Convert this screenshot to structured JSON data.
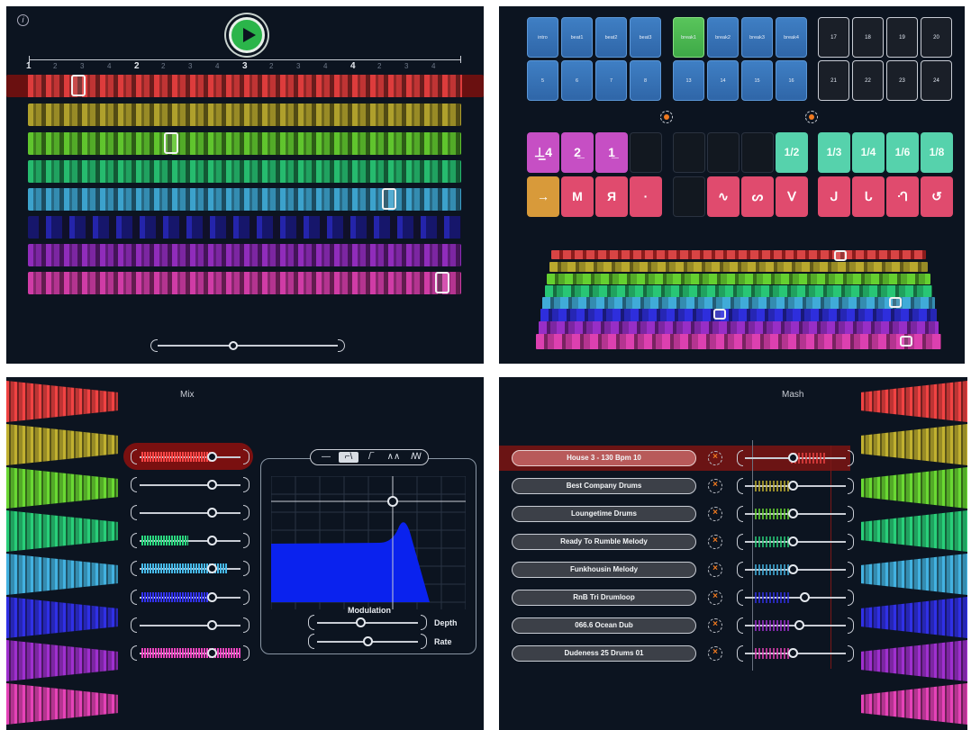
{
  "colors": {
    "background": "#0c1420",
    "tracks": [
      "#d23a3a",
      "#a89a2a",
      "#5cbd2c",
      "#24b46a",
      "#3a9bc4",
      "#2a2ac8",
      "#8a2ab4",
      "#c83aa0"
    ],
    "play": "#2bb54a",
    "accent_orange": "#f07a20"
  },
  "arranger": {
    "info_icon": "info-icon",
    "play_icon": "play-icon",
    "ruler": [
      "1",
      "2",
      "3",
      "4",
      "2",
      "2",
      "3",
      "4",
      "3",
      "2",
      "3",
      "4",
      "4",
      "2",
      "3",
      "4"
    ]
  },
  "pads": {
    "scenes_blue": [
      "intro",
      "beat1",
      "beat2",
      "beat3",
      "break1",
      "break2",
      "break3",
      "break4",
      "5",
      "6",
      "7",
      "8",
      "13",
      "14",
      "15",
      "16"
    ],
    "scenes_dark": [
      "17",
      "18",
      "19",
      "20",
      "21",
      "22",
      "23",
      "24"
    ],
    "fx_row1": [
      "⊥̲4",
      "2̲",
      "1̲",
      "",
      "",
      "",
      "",
      "1/2",
      "1/3",
      "1/4",
      "1/6",
      "1/8"
    ],
    "fx_row2": [
      "→",
      "M",
      "Я",
      "·",
      "",
      "∿",
      "ᔕ",
      "ᐯ",
      "ᒍ",
      "ᒐ",
      "ᒒ",
      "↺"
    ]
  },
  "mix": {
    "title": "Mix",
    "filter_options": [
      "—",
      "⌐\\",
      "/‾",
      "∧∧",
      "ꟿ"
    ],
    "modulation_label": "Modulation",
    "depth_label": "Depth",
    "rate_label": "Rate"
  },
  "mash": {
    "title": "Mash",
    "loops": [
      "House 3 - 130 Bpm 10",
      "Best Company Drums",
      "Loungetime Drums",
      "Ready To Rumble Melody",
      "Funkhousin Melody",
      "RnB Tri Drumloop",
      "066.6 Ocean Dub",
      "Dudeness 25 Drums 01"
    ],
    "remove_icon": "×"
  }
}
